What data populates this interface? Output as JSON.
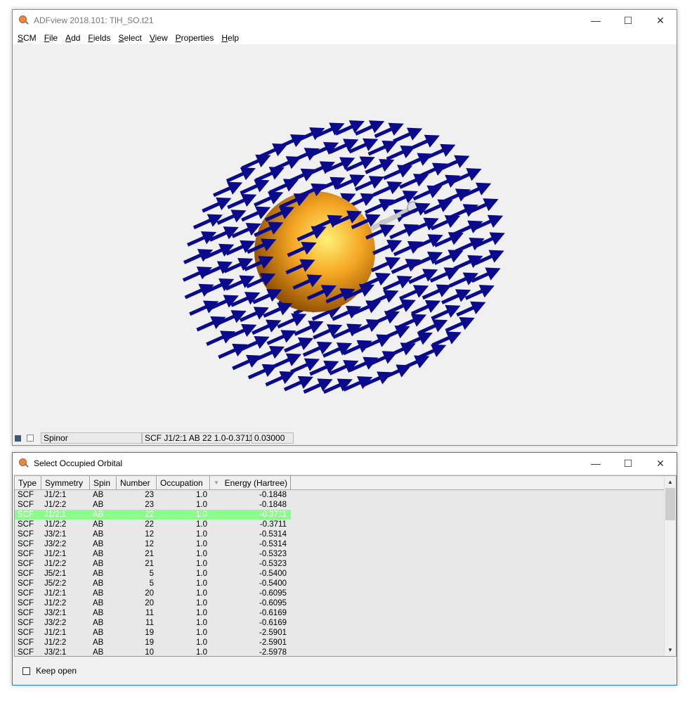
{
  "main_window": {
    "title": "ADFview 2018.101: TlH_SO.t21",
    "controls": [
      "—",
      "☐",
      "✕"
    ],
    "menu": [
      "SCM",
      "File",
      "Add",
      "Fields",
      "Select",
      "View",
      "Properties",
      "Help"
    ],
    "viewport": {
      "sphere_color": "#f5a623",
      "arrow_color": "#0a0a8c",
      "bond_color": "#c8c8c8"
    },
    "status": {
      "field_name": "Spinor",
      "orbital": "SCF J1/2:1 AB 22 1.0",
      "energy": "-0.3711",
      "isovalue": "0.03000"
    }
  },
  "orbital_window": {
    "title": "Select Occupied Orbital",
    "controls": [
      "—",
      "☐",
      "✕"
    ],
    "columns": [
      "Type",
      "Symmetry",
      "Spin",
      "Number",
      "Occupation",
      "Energy (Hartree)"
    ],
    "sort_indicator": "▼",
    "selected_row": 2,
    "selected_color": "#8cfd8c",
    "rows": [
      [
        "SCF",
        "J1/2:1",
        "AB",
        "23",
        "1.0",
        "-0.1848"
      ],
      [
        "SCF",
        "J1/2:2",
        "AB",
        "23",
        "1.0",
        "-0.1848"
      ],
      [
        "SCF",
        "J1/2:1",
        "AB",
        "22",
        "1.0",
        "-0.3711"
      ],
      [
        "SCF",
        "J1/2:2",
        "AB",
        "22",
        "1.0",
        "-0.3711"
      ],
      [
        "SCF",
        "J3/2:1",
        "AB",
        "12",
        "1.0",
        "-0.5314"
      ],
      [
        "SCF",
        "J3/2:2",
        "AB",
        "12",
        "1.0",
        "-0.5314"
      ],
      [
        "SCF",
        "J1/2:1",
        "AB",
        "21",
        "1.0",
        "-0.5323"
      ],
      [
        "SCF",
        "J1/2:2",
        "AB",
        "21",
        "1.0",
        "-0.5323"
      ],
      [
        "SCF",
        "J5/2:1",
        "AB",
        "5",
        "1.0",
        "-0.5400"
      ],
      [
        "SCF",
        "J5/2:2",
        "AB",
        "5",
        "1.0",
        "-0.5400"
      ],
      [
        "SCF",
        "J1/2:1",
        "AB",
        "20",
        "1.0",
        "-0.6095"
      ],
      [
        "SCF",
        "J1/2:2",
        "AB",
        "20",
        "1.0",
        "-0.6095"
      ],
      [
        "SCF",
        "J3/2:1",
        "AB",
        "11",
        "1.0",
        "-0.6169"
      ],
      [
        "SCF",
        "J3/2:2",
        "AB",
        "11",
        "1.0",
        "-0.6169"
      ],
      [
        "SCF",
        "J1/2:1",
        "AB",
        "19",
        "1.0",
        "-2.5901"
      ],
      [
        "SCF",
        "J1/2:2",
        "AB",
        "19",
        "1.0",
        "-2.5901"
      ],
      [
        "SCF",
        "J3/2:1",
        "AB",
        "10",
        "1.0",
        "-2.5978"
      ]
    ],
    "keep_open": {
      "label": "Keep open",
      "checked": false
    }
  }
}
